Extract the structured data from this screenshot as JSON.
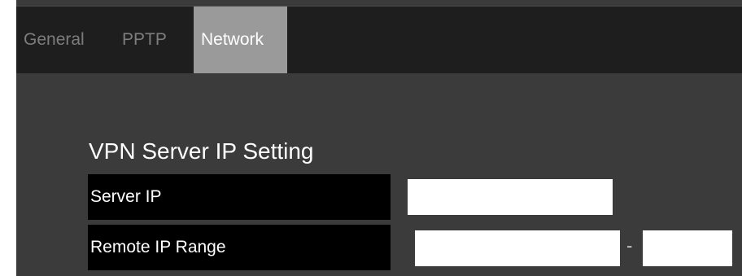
{
  "tabs": [
    {
      "label": "General",
      "active": false
    },
    {
      "label": "PPTP",
      "active": false
    },
    {
      "label": "Network",
      "active": true
    }
  ],
  "section": {
    "title": "VPN Server IP Setting"
  },
  "fields": {
    "server_ip": {
      "label": "Server IP",
      "value": ""
    },
    "remote_ip_range": {
      "label": "Remote IP Range",
      "start_value": "",
      "end_value": "",
      "separator": "-"
    }
  },
  "colors": {
    "panel_bg": "#3b3b3b",
    "tabbar_bg": "#1e1e1e",
    "active_tab_bg": "#9a9a9a",
    "label_bg": "#000000",
    "inactive_tab_text": "#7d7d7d",
    "text": "#ffffff"
  }
}
